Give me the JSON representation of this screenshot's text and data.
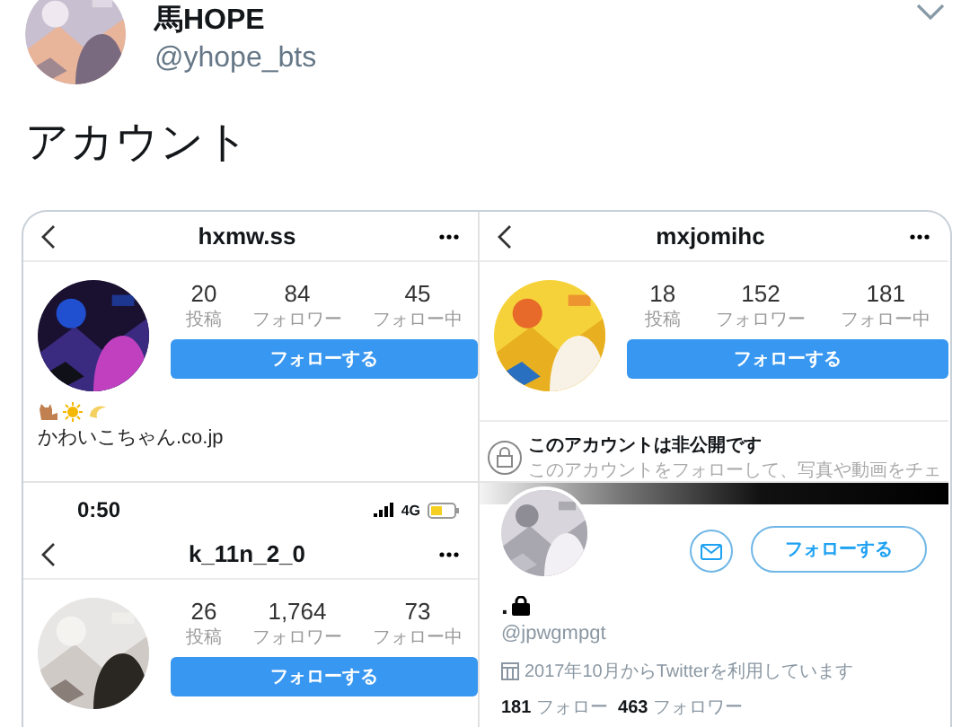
{
  "tweet": {
    "author": {
      "name": "馬HOPE",
      "handle": "@yhope_bts"
    },
    "text": "アカウント"
  },
  "image": {
    "columns": [
      {
        "panels": [
          {
            "kind": "instagram",
            "title": "hxmw.ss",
            "stats": [
              {
                "value": "20",
                "label": "投稿"
              },
              {
                "value": "84",
                "label": "フォロワー"
              },
              {
                "value": "45",
                "label": "フォロー中"
              }
            ],
            "button": "フォローする",
            "bio": "かわいこちゃん.co.jp"
          },
          {
            "kind": "instagram",
            "status_bar": {
              "time": "0:50",
              "network": "4G"
            },
            "title": "k_11n_2_0",
            "stats": [
              {
                "value": "26",
                "label": "投稿"
              },
              {
                "value": "1,764",
                "label": "フォロワー"
              },
              {
                "value": "73",
                "label": "フォロー中"
              }
            ],
            "button": "フォローする"
          }
        ]
      },
      {
        "panels": [
          {
            "kind": "instagram",
            "title": "mxjomihc",
            "stats": [
              {
                "value": "18",
                "label": "投稿"
              },
              {
                "value": "152",
                "label": "フォロワー"
              },
              {
                "value": "181",
                "label": "フォロー中"
              }
            ],
            "button": "フォローする",
            "private_notice": {
              "title": "このアカウントは非公開です",
              "text": "このアカウントをフォローして、写真や動画をチェ"
            }
          },
          {
            "kind": "twitter",
            "name": ".",
            "handle": "@jpwgmpgt",
            "joined": "2017年10月からTwitterを利用しています",
            "counts": "**181** フォロー  **463** フォロワー",
            "button": "フォローする"
          }
        ]
      }
    ]
  }
}
